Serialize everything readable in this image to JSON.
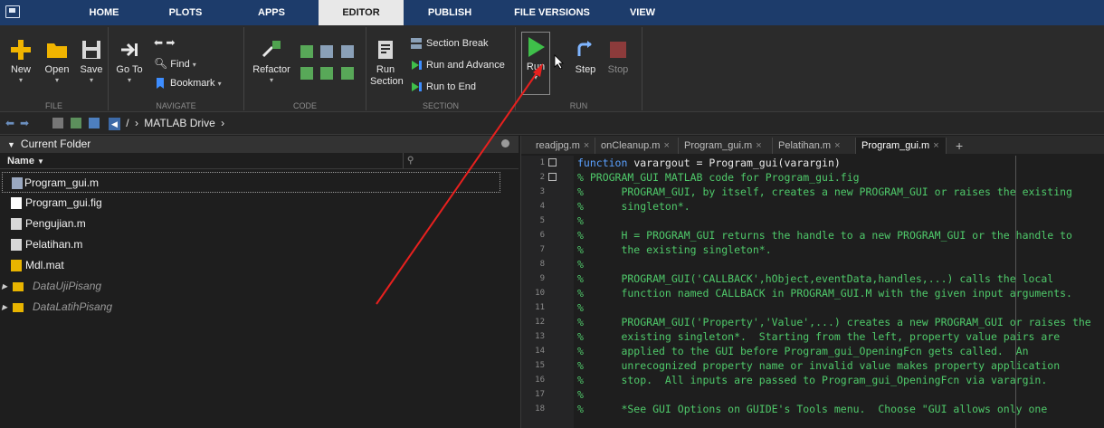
{
  "tabs": [
    "HOME",
    "PLOTS",
    "APPS",
    "EDITOR",
    "PUBLISH",
    "FILE VERSIONS",
    "VIEW"
  ],
  "active_tab": "EDITOR",
  "ribbon": {
    "file": {
      "new": "New",
      "open": "Open",
      "save": "Save",
      "group": "FILE"
    },
    "navigate": {
      "goto": "Go To",
      "find": "Find",
      "bookmark": "Bookmark",
      "group": "NAVIGATE"
    },
    "code": {
      "refactor": "Refactor",
      "group": "CODE"
    },
    "section": {
      "run_section": "Run Section",
      "section_break": "Section Break",
      "run_and_advance": "Run and Advance",
      "run_to_end": "Run to End",
      "group": "SECTION"
    },
    "run": {
      "run": "Run",
      "step": "Step",
      "stop": "Stop",
      "group": "RUN"
    }
  },
  "address": {
    "separator": "/",
    "path": "MATLAB Drive"
  },
  "folder_panel": {
    "title": "Current Folder",
    "column": "Name",
    "files": [
      {
        "name": "Program_gui.m",
        "type": "m-gui-file",
        "selected": true
      },
      {
        "name": "Program_gui.fig",
        "type": "fig-file"
      },
      {
        "name": "Pengujian.m",
        "type": "m-file"
      },
      {
        "name": "Pelatihan.m",
        "type": "m-file"
      },
      {
        "name": "Mdl.mat",
        "type": "mat-file"
      },
      {
        "name": "DataUjiPisang",
        "type": "folder"
      },
      {
        "name": "DataLatihPisang",
        "type": "folder"
      }
    ]
  },
  "editor": {
    "tabs": [
      {
        "name": "readjpg.m",
        "close": "×"
      },
      {
        "name": "onCleanup.m",
        "close": "×"
      },
      {
        "name": "Program_gui.m",
        "close": "×"
      },
      {
        "name": "Pelatihan.m",
        "close": "×"
      },
      {
        "name": "Program_gui.m",
        "close": "×",
        "active": true
      }
    ],
    "add_tab": "+",
    "line_numbers": [
      "1",
      "2",
      "3",
      "4",
      "5",
      "6",
      "7",
      "8",
      "9",
      "10",
      "11",
      "12",
      "13",
      "14",
      "15",
      "16",
      "17",
      "18"
    ],
    "first_line": {
      "keyword": "function",
      "rest": " varargout = Program_gui(varargin)"
    },
    "comment_lines": [
      "% PROGRAM_GUI MATLAB code for Program_gui.fig",
      "%      PROGRAM_GUI, by itself, creates a new PROGRAM_GUI or raises the existing",
      "%      singleton*.",
      "%",
      "%      H = PROGRAM_GUI returns the handle to a new PROGRAM_GUI or the handle to",
      "%      the existing singleton*.",
      "%",
      "%      PROGRAM_GUI('CALLBACK',hObject,eventData,handles,...) calls the local",
      "%      function named CALLBACK in PROGRAM_GUI.M with the given input arguments.",
      "%",
      "%      PROGRAM_GUI('Property','Value',...) creates a new PROGRAM_GUI or raises the",
      "%      existing singleton*.  Starting from the left, property value pairs are",
      "%      applied to the GUI before Program_gui_OpeningFcn gets called.  An",
      "%      unrecognized property name or invalid value makes property application",
      "%      stop.  All inputs are passed to Program_gui_OpeningFcn via varargin.",
      "%",
      "%      *See GUI Options on GUIDE's Tools menu.  Choose \"GUI allows only one"
    ]
  },
  "colors": {
    "tabbar": "#1d3c6b",
    "ribbon": "#2b2b2b",
    "keyword": "#5aa0ff",
    "comment": "#4fc96a",
    "annotation_arrow": "#e8201e",
    "run_icon": "#3fbf4a",
    "stop_icon": "#8c3b3b"
  }
}
